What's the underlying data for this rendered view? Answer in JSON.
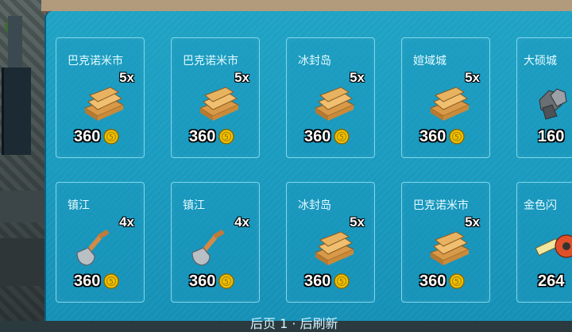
{
  "colors": {
    "panel": "#1a9bbf",
    "card_border": "#7fd6ea",
    "coin": "#f2c200"
  },
  "icons": {
    "planks": "wood-planks-icon",
    "shovel": "shovel-icon",
    "metal": "metal-ore-icon",
    "tape": "measuring-tape-icon",
    "coin": "coin-icon"
  },
  "cards": [
    {
      "place": "巴克诺米市",
      "qty": "5x",
      "item": "planks",
      "price": "360"
    },
    {
      "place": "巴克诺米市",
      "qty": "5x",
      "item": "planks",
      "price": "360"
    },
    {
      "place": "冰封岛",
      "qty": "5x",
      "item": "planks",
      "price": "360"
    },
    {
      "place": "媗域城",
      "qty": "5x",
      "item": "planks",
      "price": "360"
    },
    {
      "place": "大硕城",
      "qty": "",
      "item": "metal",
      "price": "160"
    },
    {
      "place": "镇江",
      "qty": "4x",
      "item": "shovel",
      "price": "360"
    },
    {
      "place": "镇江",
      "qty": "4x",
      "item": "shovel",
      "price": "360"
    },
    {
      "place": "冰封岛",
      "qty": "5x",
      "item": "planks",
      "price": "360"
    },
    {
      "place": "巴克诺米市",
      "qty": "5x",
      "item": "planks",
      "price": "360"
    },
    {
      "place": "金色闪",
      "qty": "",
      "item": "tape",
      "price": "264"
    }
  ],
  "footer": {
    "text": "后页 1 · 后刷新"
  }
}
